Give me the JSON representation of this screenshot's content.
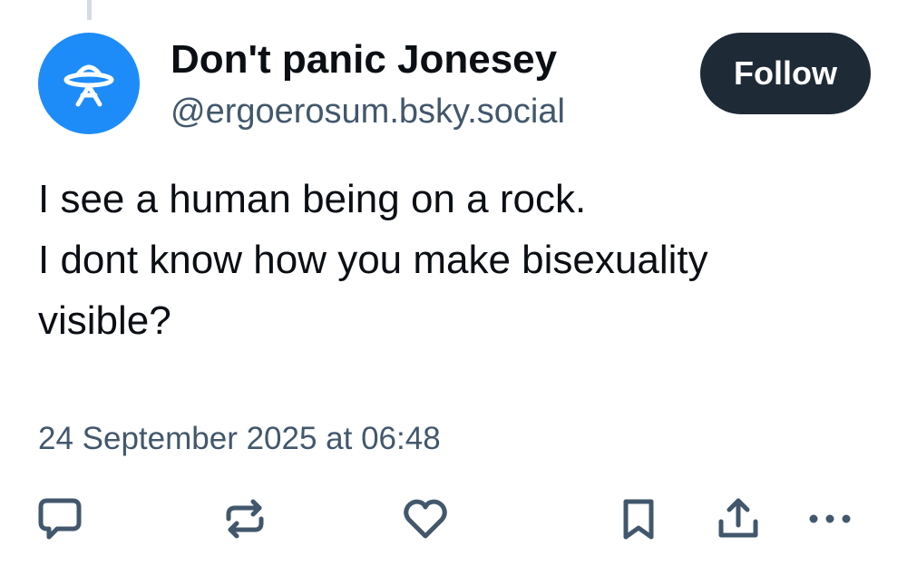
{
  "post": {
    "author": {
      "display_name": "Don't panic Jonesey",
      "handle": "@ergoerosum.bsky.social",
      "avatar_icon": "ufo-icon",
      "avatar_color": "#1d8cf8"
    },
    "follow_label": "Follow",
    "text_lines": [
      "I see a human being on a rock.",
      "I dont know how you make bisexuality",
      "visible?"
    ],
    "timestamp": "24 September 2025 at 06:48"
  },
  "actions": [
    {
      "name": "reply",
      "icon": "comment-icon"
    },
    {
      "name": "repost",
      "icon": "repost-icon"
    },
    {
      "name": "like",
      "icon": "heart-icon"
    },
    {
      "name": "bookmark",
      "icon": "bookmark-icon"
    },
    {
      "name": "share",
      "icon": "share-icon"
    },
    {
      "name": "more",
      "icon": "more-icon"
    }
  ],
  "colors": {
    "text_primary": "#0b0f14",
    "text_secondary": "#42576c",
    "follow_button_bg": "#1f2a37",
    "icon_color": "#42576c",
    "thread_line": "#d4dbe2"
  }
}
